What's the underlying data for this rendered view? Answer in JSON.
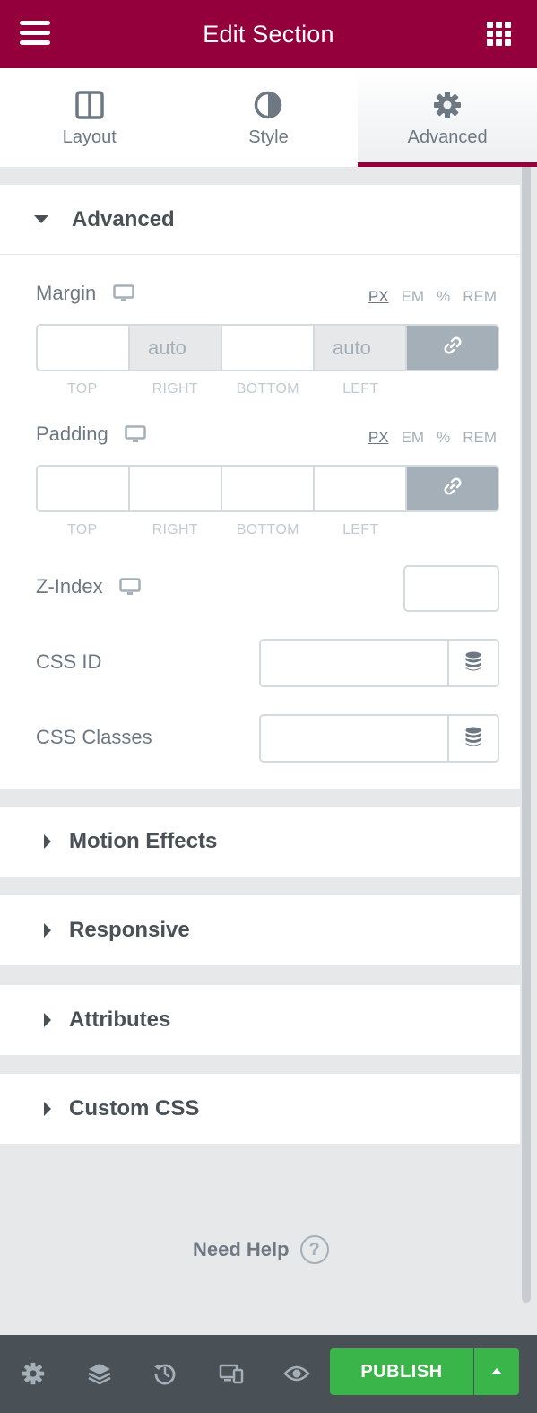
{
  "header": {
    "title": "Edit Section",
    "menu_icon": "hamburger-icon",
    "apps_icon": "grid-icon",
    "bg_color": "#93003c"
  },
  "tabs": [
    {
      "label": "Layout",
      "icon": "columns-icon"
    },
    {
      "label": "Style",
      "icon": "half-circle-icon"
    },
    {
      "label": "Advanced",
      "icon": "gear-icon",
      "active": true
    }
  ],
  "advanced": {
    "title": "Advanced",
    "margin": {
      "label": "Margin",
      "units": [
        "PX",
        "EM",
        "%",
        "REM"
      ],
      "active_unit": "PX",
      "values": {
        "top": "",
        "right": "auto",
        "bottom": "",
        "left": "auto"
      },
      "placeholders": {
        "right": "auto",
        "left": "auto"
      },
      "side_labels": [
        "TOP",
        "RIGHT",
        "BOTTOM",
        "LEFT"
      ]
    },
    "padding": {
      "label": "Padding",
      "units": [
        "PX",
        "EM",
        "%",
        "REM"
      ],
      "active_unit": "PX",
      "values": {
        "top": "",
        "right": "",
        "bottom": "",
        "left": ""
      },
      "side_labels": [
        "TOP",
        "RIGHT",
        "BOTTOM",
        "LEFT"
      ]
    },
    "z_index": {
      "label": "Z-Index",
      "value": ""
    },
    "css_id": {
      "label": "CSS ID",
      "value": ""
    },
    "css_classes": {
      "label": "CSS Classes",
      "value": ""
    }
  },
  "sections": [
    {
      "title": "Motion Effects"
    },
    {
      "title": "Responsive"
    },
    {
      "title": "Attributes"
    },
    {
      "title": "Custom CSS"
    }
  ],
  "help": {
    "label": "Need Help",
    "icon": "question-icon"
  },
  "footer": {
    "icons": [
      "settings-icon",
      "layers-icon",
      "history-icon",
      "responsive-icon",
      "preview-icon"
    ],
    "publish_label": "PUBLISH",
    "publish_color": "#39b54a"
  }
}
